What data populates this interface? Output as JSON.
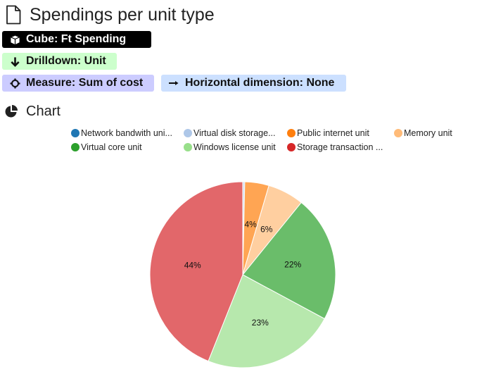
{
  "header": {
    "title": "Spendings per unit type",
    "title_icon": "document-icon"
  },
  "tags": {
    "cube": {
      "label": "Cube: Ft Spending",
      "icon": "cube-icon",
      "bg": "#000000",
      "fg": "#ffffff"
    },
    "drilldown": {
      "label": "Drilldown: Unit",
      "icon": "arrow-down-icon",
      "bg": "#ccffcc"
    },
    "measure": {
      "label": "Measure: Sum of cost",
      "icon": "crosshair-icon",
      "bg": "#ccccff"
    },
    "horizontal": {
      "label": "Horizontal dimension: None",
      "icon": "arrow-right-icon",
      "bg": "#cce0ff"
    }
  },
  "section": {
    "label": "Chart",
    "icon": "pie-chart-icon"
  },
  "chart_data": {
    "type": "pie",
    "title": "",
    "legend_position": "top",
    "start_angle": "top, clockwise",
    "series": [
      {
        "name": "Network bandwith uni...",
        "value": 0.05,
        "label": "",
        "color": "#1f77b4",
        "slice_color": "#1f77b4"
      },
      {
        "name": "Virtual disk storage...",
        "value": 0.3,
        "label": "",
        "color": "#aec7e8",
        "slice_color": "#c3d6ef"
      },
      {
        "name": "Public internet unit",
        "value": 4.2,
        "label": "4%",
        "color": "#ff7f0e",
        "slice_color": "#ffa553"
      },
      {
        "name": "Memory unit",
        "value": 6.3,
        "label": "6%",
        "color": "#ffbb78",
        "slice_color": "#ffcfa0"
      },
      {
        "name": "Virtual core unit",
        "value": 22.0,
        "label": "22%",
        "color": "#2ca02c",
        "slice_color": "#6abd6a"
      },
      {
        "name": "Windows license unit",
        "value": 23.2,
        "label": "23%",
        "color": "#98df8a",
        "slice_color": "#b7e8ad"
      },
      {
        "name": "Storage transaction ...",
        "value": 43.95,
        "label": "44%",
        "color": "#d62728",
        "slice_color": "#e2676a"
      }
    ]
  }
}
